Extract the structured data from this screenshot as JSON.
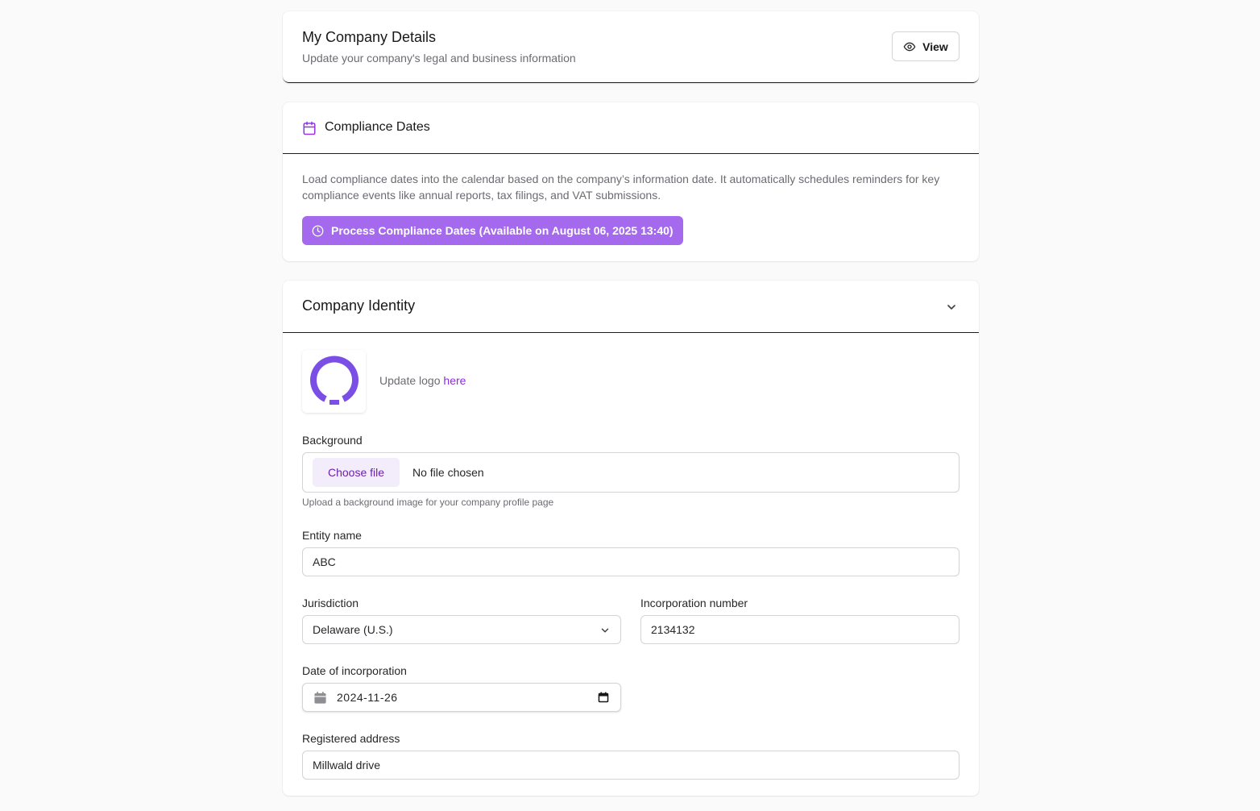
{
  "details": {
    "title": "My Company Details",
    "subtitle": "Update your company's legal and business information",
    "view_label": "View"
  },
  "compliance": {
    "title": "Compliance Dates",
    "description": "Load compliance dates into the calendar based on the company’s information date. It automatically schedules reminders for key compliance events like annual reports, tax filings, and VAT submissions.",
    "button_label": "Process Compliance Dates (Available on August 06, 2025 13:40)"
  },
  "identity": {
    "title": "Company Identity",
    "logo_prefix": "Update logo ",
    "logo_link": "here",
    "background": {
      "label": "Background",
      "choose_label": "Choose file",
      "status": "No file chosen",
      "help": "Upload a background image for your company profile page"
    },
    "entity_name": {
      "label": "Entity name",
      "value": "ABC"
    },
    "jurisdiction": {
      "label": "Jurisdiction",
      "value": "Delaware (U.S.)"
    },
    "incorporation_number": {
      "label": "Incorporation number",
      "value": "2134132"
    },
    "date_of_incorporation": {
      "label": "Date of incorporation",
      "value": "2024-11-26"
    },
    "registered_address": {
      "label": "Registered address",
      "value": "Millwald drive"
    }
  },
  "colors": {
    "accent": "#a569ee",
    "link": "#8a2be2",
    "logo": "#7b4fe6"
  },
  "icons": {
    "view": "eye-icon",
    "compliance": "calendar-icon",
    "process": "clock-icon",
    "collapse": "chevron-down-icon",
    "select": "chevron-down-icon",
    "date_field": "calendar-icon",
    "date_picker": "calendar-picker-icon"
  }
}
